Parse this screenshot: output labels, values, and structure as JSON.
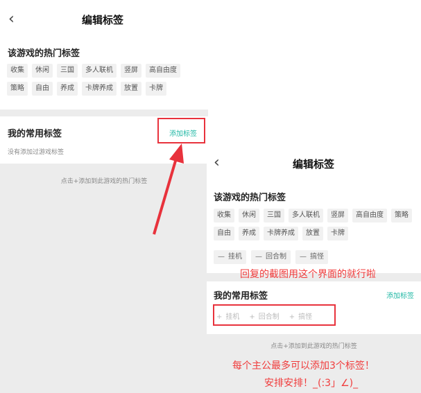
{
  "left": {
    "header": {
      "back_icon": "chevron-left-icon",
      "title": "编辑标签"
    },
    "hot_section_title": "该游戏的热门标签",
    "hot_tags": [
      "收集",
      "休闲",
      "三国",
      "多人联机",
      "竖屏",
      "高自由度",
      "策略",
      "自由",
      "养成",
      "卡牌养成",
      "放置",
      "卡牌"
    ],
    "common_section_title": "我的常用标签",
    "add_tags_label": "添加标签",
    "empty_text": "没有添加过游戏标签",
    "hint": "点击+添加到此游戏的热门标签"
  },
  "right": {
    "header": {
      "back_icon": "chevron-left-icon",
      "title": "编辑标签"
    },
    "hot_section_title": "该游戏的热门标签",
    "hot_tags": [
      "收集",
      "休闲",
      "三国",
      "多人联机",
      "竖屏",
      "高自由度",
      "策略",
      "自由",
      "养成",
      "卡牌养成",
      "放置",
      "卡牌"
    ],
    "selected_tags": [
      {
        "prefix": "—",
        "label": "挂机"
      },
      {
        "prefix": "—",
        "label": "回合制"
      },
      {
        "prefix": "—",
        "label": "搞怪"
      }
    ],
    "common_section_title": "我的常用标签",
    "add_tags_label": "添加标签",
    "common_tags": [
      {
        "prefix": "+",
        "label": "挂机"
      },
      {
        "prefix": "+",
        "label": "回合制"
      },
      {
        "prefix": "+",
        "label": "搞怪"
      }
    ],
    "hint": "点击+添加到此游戏的热门标签"
  },
  "annotations": {
    "screenshot_note": "回复的截图用这个界面的就行啦",
    "limit_note": "每个主公最多可以添加3个标签！",
    "arrange_note": "安排安排！_(:3」∠)_"
  },
  "colors": {
    "accent": "#21b8a5",
    "annotation_red": "#e8323c"
  }
}
